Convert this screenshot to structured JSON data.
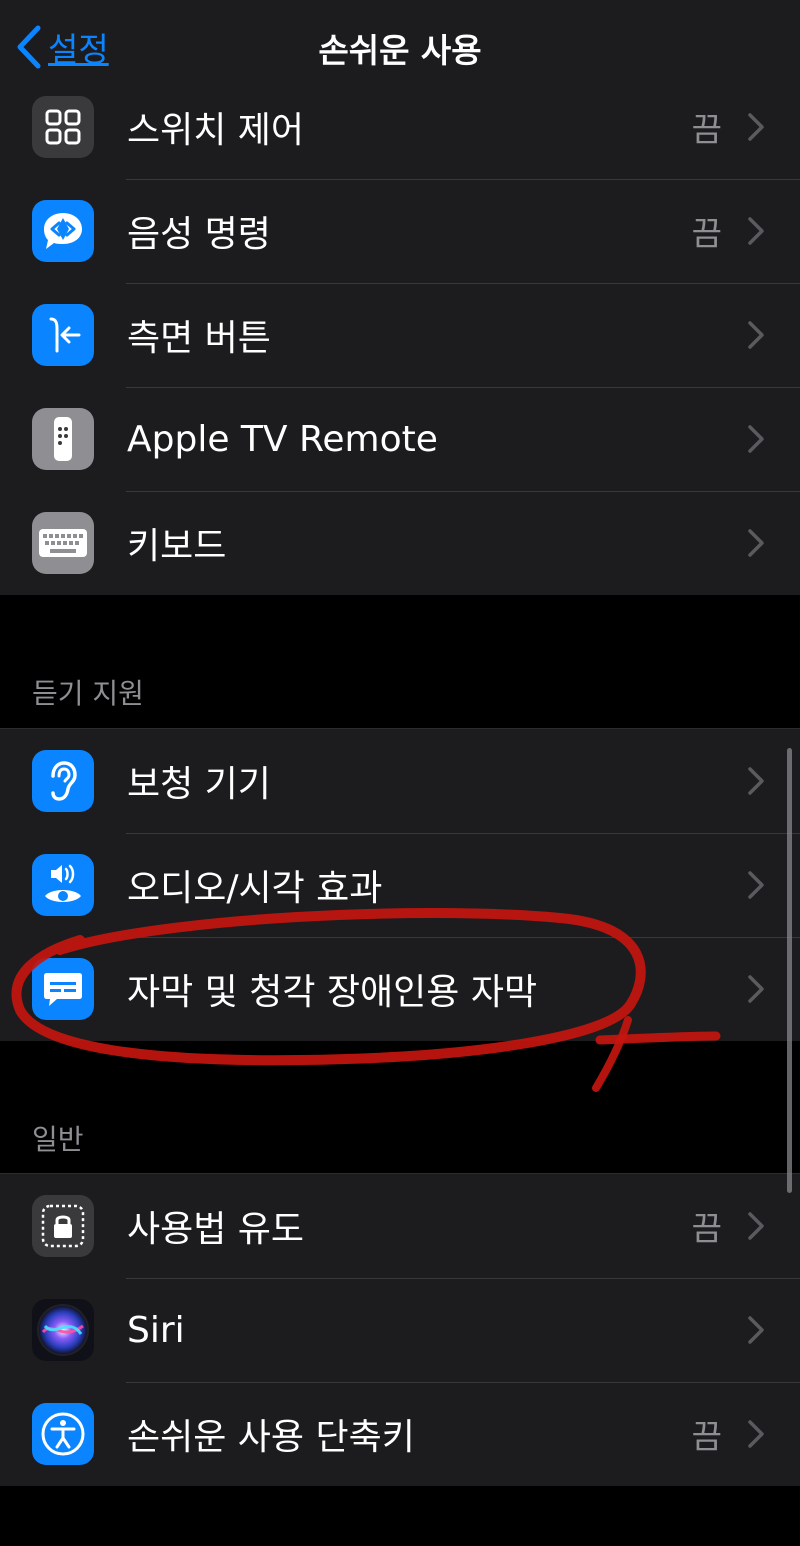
{
  "nav": {
    "back_label": "설정",
    "title": "손쉬운 사용"
  },
  "colors": {
    "blue": "#0a84ff",
    "gray_icon": "#636366",
    "dark_icon": "#3a3a3c",
    "annotation_red": "#c4160f"
  },
  "group_top": {
    "rows": [
      {
        "label": "스위치 제어",
        "value": "끔",
        "icon": "switch-control-icon"
      },
      {
        "label": "음성 명령",
        "value": "끔",
        "icon": "voice-control-icon"
      },
      {
        "label": "측면 버튼",
        "value": "",
        "icon": "side-button-icon"
      },
      {
        "label": "Apple TV Remote",
        "value": "",
        "icon": "tv-remote-icon"
      },
      {
        "label": "키보드",
        "value": "",
        "icon": "keyboard-icon"
      }
    ]
  },
  "hearing": {
    "header": "듣기 지원",
    "rows": [
      {
        "label": "보청 기기",
        "icon": "ear-icon"
      },
      {
        "label": "오디오/시각 효과",
        "icon": "audio-visual-icon"
      },
      {
        "label": "자막 및 청각 장애인용 자막",
        "icon": "subtitles-icon"
      }
    ]
  },
  "general": {
    "header": "일반",
    "rows": [
      {
        "label": "사용법 유도",
        "value": "끔",
        "icon": "guided-access-icon"
      },
      {
        "label": "Siri",
        "value": "",
        "icon": "siri-icon"
      },
      {
        "label": "손쉬운 사용 단축키",
        "value": "끔",
        "icon": "accessibility-shortcut-icon"
      }
    ]
  }
}
